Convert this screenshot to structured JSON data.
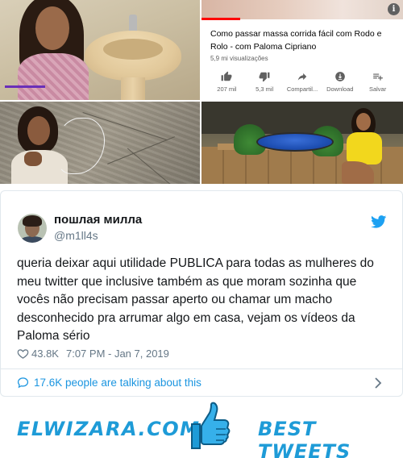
{
  "video_card": {
    "title": "Como passar massa corrida fácil com Rodo e Rolo - com Paloma Cipriano",
    "views": "5,9 mi visualizações",
    "info_icon": "info-icon",
    "actions": [
      {
        "icon": "thumbs-up-icon",
        "label": "207 mil"
      },
      {
        "icon": "thumbs-down-icon",
        "label": "5,3 mil"
      },
      {
        "icon": "share-icon",
        "label": "Compartil..."
      },
      {
        "icon": "download-icon",
        "label": "Download"
      },
      {
        "icon": "add-to-playlist-icon",
        "label": "Salvar"
      }
    ]
  },
  "tweet": {
    "display_name": "пошлая милла",
    "handle": "@m1ll4s",
    "text": "queria deixar aqui utilidade PUBLICA para todas as mulheres do meu twitter que inclusive também as que moram sozinha que vocês não precisam passar aperto ou chamar um macho desconhecido pra arrumar algo em casa, vejam os vídeos da Paloma sério",
    "likes": "43.8K",
    "timestamp": "7:07 PM - Jan 7, 2019",
    "talking": "17.6K people are talking about this"
  },
  "banner": {
    "site": "ELWIZARA.COM",
    "tagline": "BEST TWEETS"
  },
  "colors": {
    "twitter_blue": "#1da1f2",
    "link_blue": "#1b95e0",
    "banner_blue": "#1e9bd7",
    "youtube_red": "#ff0000"
  }
}
